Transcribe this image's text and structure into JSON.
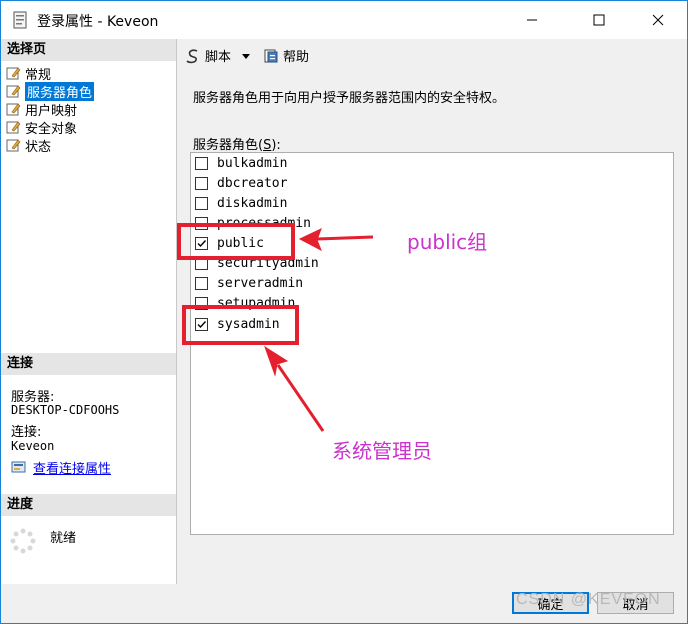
{
  "window": {
    "title": "登录属性 - Keveon"
  },
  "left": {
    "select_page_header": "选择页",
    "pages": [
      {
        "label": "常规",
        "selected": false
      },
      {
        "label": "服务器角色",
        "selected": true
      },
      {
        "label": "用户映射",
        "selected": false
      },
      {
        "label": "安全对象",
        "selected": false
      },
      {
        "label": "状态",
        "selected": false
      }
    ],
    "connection_header": "连接",
    "server_label": "服务器:",
    "server_value": "DESKTOP-CDFOOHS",
    "connection_label": "连接:",
    "connection_value": "Keveon",
    "view_connection_link": "查看连接属性",
    "progress_header": "进度",
    "progress_status": "就绪"
  },
  "toolbar": {
    "script_label": "脚本",
    "help_label": "帮助"
  },
  "main": {
    "description": "服务器角色用于向用户授予服务器范围内的安全特权。",
    "roles_label_prefix": "服务器角色(",
    "roles_label_hotkey": "S",
    "roles_label_suffix": "):",
    "roles": [
      {
        "name": "bulkadmin",
        "checked": false
      },
      {
        "name": "dbcreator",
        "checked": false
      },
      {
        "name": "diskadmin",
        "checked": false
      },
      {
        "name": "processadmin",
        "checked": false
      },
      {
        "name": "public",
        "checked": true
      },
      {
        "name": "securityadmin",
        "checked": false
      },
      {
        "name": "serveradmin",
        "checked": false
      },
      {
        "name": "setupadmin",
        "checked": false
      },
      {
        "name": "sysadmin",
        "checked": true
      }
    ]
  },
  "annotations": {
    "public_note": "public组",
    "sysadmin_note": "系统管理员"
  },
  "footer": {
    "ok_label": "确定",
    "cancel_label": "取消",
    "watermark": "CSDN @KEVEON"
  },
  "colors": {
    "accent": "#0078d7",
    "annotation_red": "#e5202e",
    "annotation_text": "#cc33cc"
  }
}
